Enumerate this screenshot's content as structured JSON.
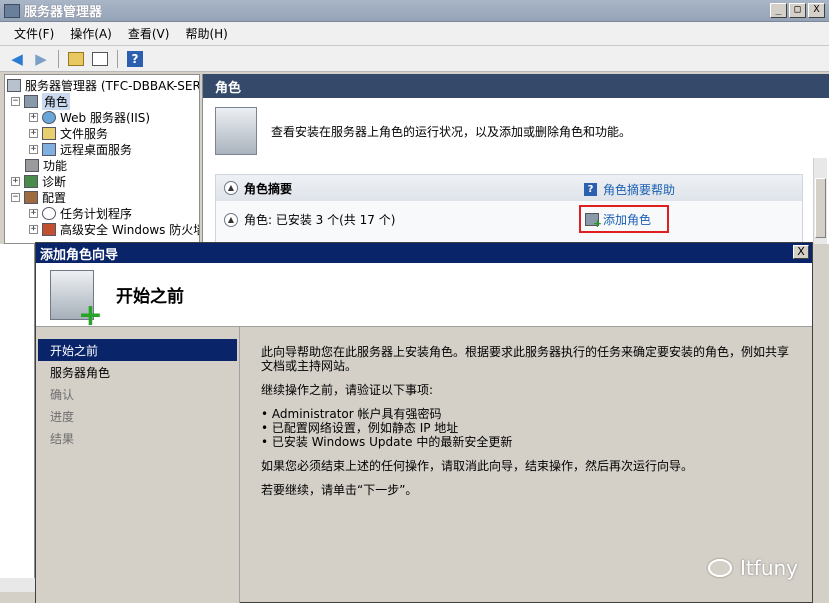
{
  "window": {
    "title": "服务器管理器",
    "controls": [
      "_",
      "□",
      "X"
    ]
  },
  "menu": [
    "文件(F)",
    "操作(A)",
    "查看(V)",
    "帮助(H)"
  ],
  "toolbar": {
    "icons": [
      "back-arrow-icon",
      "forward-arrow-icon",
      "up-folder-icon",
      "show-hide-tree-icon",
      "help-icon"
    ],
    "help_glyph": "?"
  },
  "tree": {
    "items": [
      {
        "label": "服务器管理器 (TFC-DBBAK-SERV",
        "expander": ""
      },
      {
        "label": "角色",
        "expander": "−"
      },
      {
        "label": "Web 服务器(IIS)",
        "expander": "+"
      },
      {
        "label": "文件服务",
        "expander": "+"
      },
      {
        "label": "远程桌面服务",
        "expander": "+"
      },
      {
        "label": "功能",
        "expander": ""
      },
      {
        "label": "诊断",
        "expander": "+"
      },
      {
        "label": "配置",
        "expander": "−"
      },
      {
        "label": "任务计划程序",
        "expander": "+"
      },
      {
        "label": "高级安全 Windows 防火墙",
        "expander": "+"
      }
    ]
  },
  "right": {
    "header": "角色",
    "intro": "查看安装在服务器上角色的运行状况，以及添加或删除角色和功能。",
    "summary_title": "角色摘要",
    "summary_help": "角色摘要帮助",
    "roles_line": "角色: 已安装 3 个(共 17 个)",
    "add_role": "添加角色"
  },
  "wizard": {
    "title": "添加角色向导",
    "close": "X",
    "heading": "开始之前",
    "nav": [
      {
        "label": "开始之前",
        "state": "active"
      },
      {
        "label": "服务器角色",
        "state": "normal"
      },
      {
        "label": "确认",
        "state": "disabled"
      },
      {
        "label": "进度",
        "state": "disabled"
      },
      {
        "label": "结果",
        "state": "disabled"
      }
    ],
    "content": {
      "p1": "此向导帮助您在此服务器上安装角色。根据要求此服务器执行的任务来确定要安装的角色，例如共享文档或主持网站。",
      "p2": "继续操作之前，请验证以下事项:",
      "bullets": [
        "• Administrator 帐户具有强密码",
        "• 已配置网络设置，例如静态 IP 地址",
        "• 已安装 Windows Update 中的最新安全更新"
      ],
      "p3": "如果您必须结束上述的任何操作，请取消此向导，结束操作，然后再次运行向导。",
      "p4": "若要继续，请单击“下一步”。"
    },
    "watermark": "Itfuny"
  },
  "colors": {
    "wizard_title_bg": "#0a246a",
    "pane_header_bg": "#35496b",
    "highlight_box": "#e02020",
    "link": "#1a5fb4"
  }
}
